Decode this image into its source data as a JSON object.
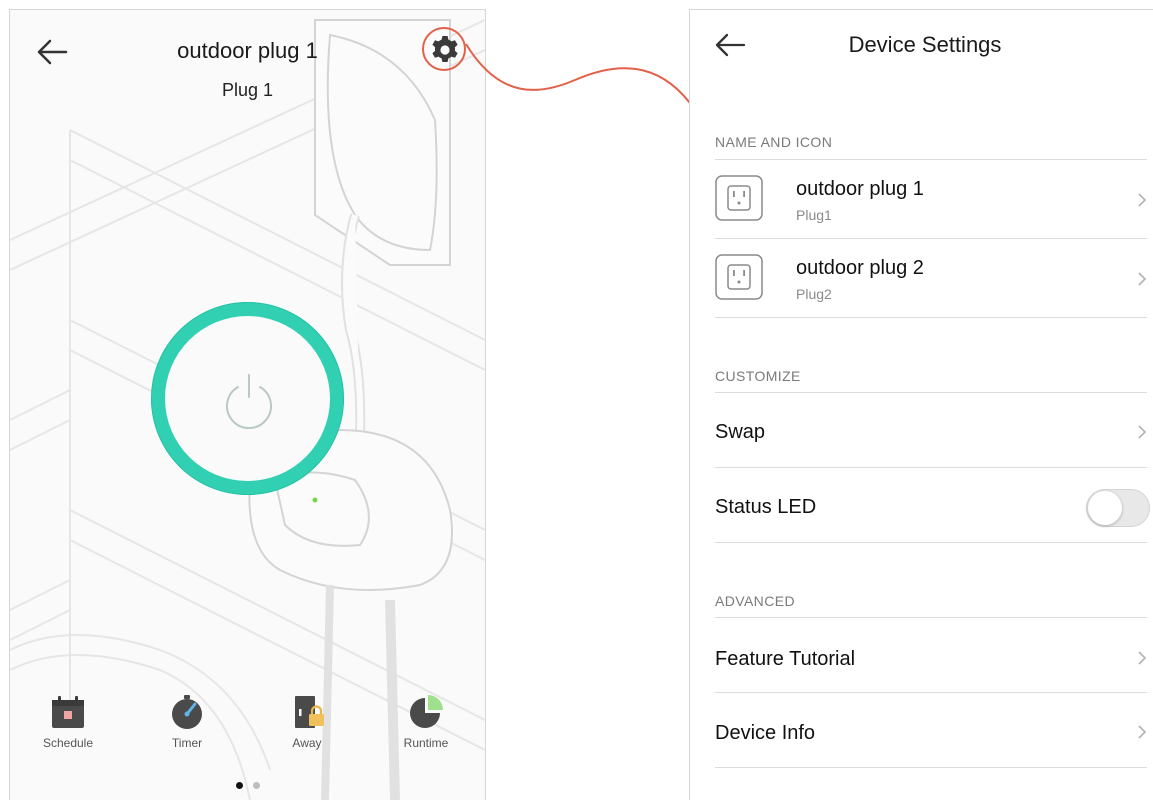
{
  "left_screen": {
    "title": "outdoor plug 1",
    "subtitle": "Plug 1",
    "power_state": "on",
    "accent_color": "#31d0b2",
    "icons": {
      "back": "arrow-left-icon",
      "settings": "gear-icon",
      "power": "power-icon"
    },
    "bottom_nav": [
      {
        "label": "Schedule",
        "icon": "calendar-icon"
      },
      {
        "label": "Timer",
        "icon": "stopwatch-icon"
      },
      {
        "label": "Away",
        "icon": "door-lock-icon"
      },
      {
        "label": "Runtime",
        "icon": "pie-chart-icon"
      }
    ],
    "pager": {
      "pages": 2,
      "active": 1
    }
  },
  "callout_color": "#e2614a",
  "right_screen": {
    "title": "Device Settings",
    "sections": {
      "name_and_icon": {
        "header": "NAME AND ICON",
        "devices": [
          {
            "name": "outdoor plug 1",
            "sub": "Plug1",
            "icon": "outlet-icon"
          },
          {
            "name": "outdoor plug 2",
            "sub": "Plug2",
            "icon": "outlet-icon"
          }
        ]
      },
      "customize": {
        "header": "CUSTOMIZE",
        "swap": "Swap",
        "status_led": "Status LED",
        "status_led_on": false
      },
      "advanced": {
        "header": "ADVANCED",
        "feature_tutorial": "Feature Tutorial",
        "device_info": "Device Info"
      }
    }
  }
}
